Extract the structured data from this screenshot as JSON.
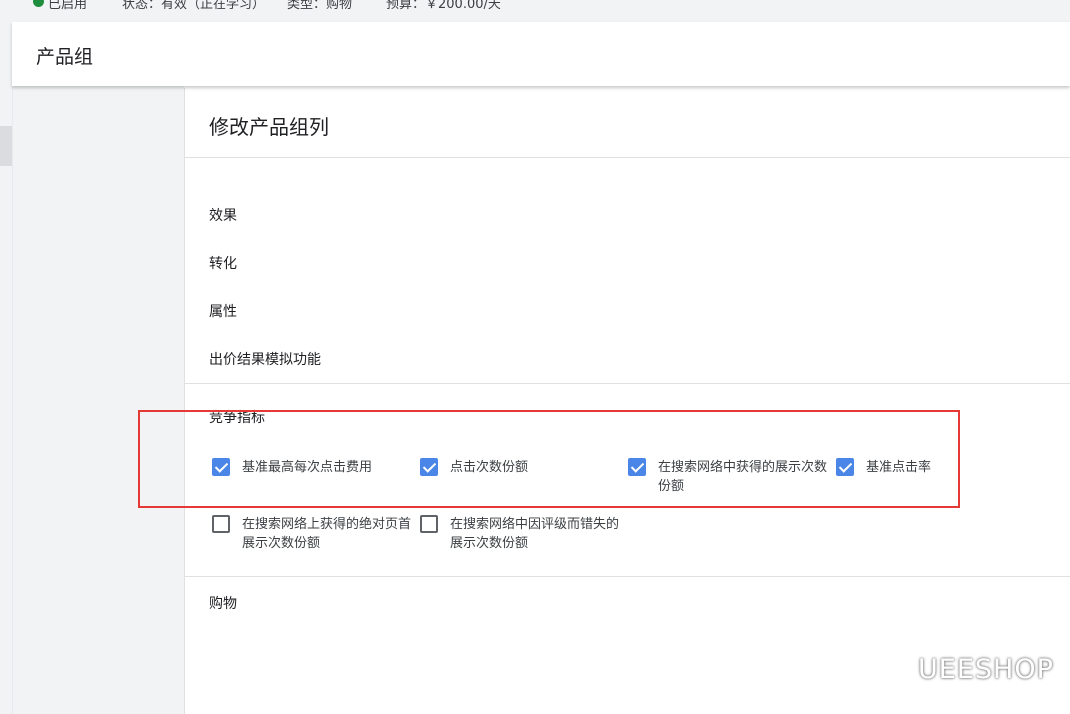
{
  "top_bar": {
    "status": "已启用",
    "state": "状态：有效（正在学习）",
    "type": "类型：购物",
    "budget": "预算：￥200.00/天"
  },
  "header": {
    "title": "产品组"
  },
  "panel": {
    "title": "修改产品组列",
    "categories": [
      "效果",
      "转化",
      "属性",
      "出价结果模拟功能"
    ],
    "competitive": {
      "label": "竞争指标",
      "options": [
        {
          "label": "基准最高每次点击费用",
          "checked": true
        },
        {
          "label": "点击次数份额",
          "checked": true
        },
        {
          "label": "在搜索网络中获得的展示次数份额",
          "checked": true
        },
        {
          "label": "基准点击率",
          "checked": true
        },
        {
          "label": "在搜索网络上获得的绝对页首展示次数份额",
          "checked": false
        },
        {
          "label": "在搜索网络中因评级而错失的展示次数份额",
          "checked": false
        }
      ]
    },
    "shopping": "购物"
  },
  "watermark": {
    "text": "UEESHOP",
    "icon": "wechat-icon"
  },
  "colors": {
    "checkbox_checked": "#4a86e8",
    "highlight_box": "#e53935",
    "status_dot": "#1e8e3e"
  }
}
